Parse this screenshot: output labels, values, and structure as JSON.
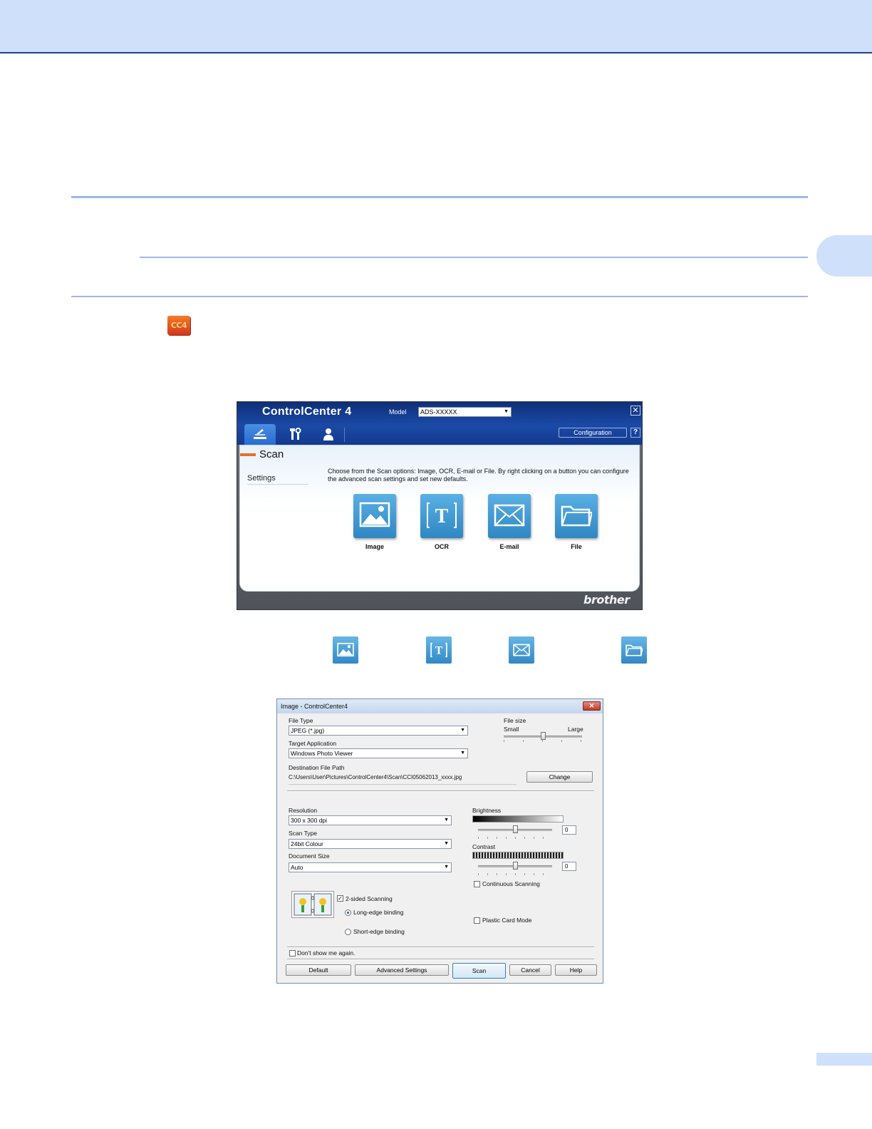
{
  "cc4_icon": {
    "text": "CC4",
    "icon": "controlcenter4-app-icon"
  },
  "controlcenter": {
    "title": "ControlCenter 4",
    "model_label": "Model",
    "model_value": "ADS-XXXXX",
    "tabs": [
      {
        "icon": "scan-tab-icon",
        "selected": true
      },
      {
        "icon": "device-settings-tab-icon",
        "selected": false
      },
      {
        "icon": "support-tab-icon",
        "selected": false
      }
    ],
    "configuration_label": "Configuration",
    "help_label": "?",
    "heading": "Scan",
    "sidebar_item": "Settings",
    "description": "Choose from the Scan options: Image, OCR, E-mail or File. By right clicking on a button you can configure the advanced scan settings and set new defaults.",
    "buttons": [
      {
        "label": "Image",
        "icon": "image-icon"
      },
      {
        "label": "OCR",
        "icon": "ocr-icon"
      },
      {
        "label": "E-mail",
        "icon": "email-icon"
      },
      {
        "label": "File",
        "icon": "folder-icon"
      }
    ],
    "brand": "brother",
    "accent_color": "#1b4aa7"
  },
  "image_dialog": {
    "title": "Image - ControlCenter4",
    "file_type_label": "File Type",
    "file_type_value": "JPEG (*.jpg)",
    "file_size_label": "File size",
    "file_size_small": "Small",
    "file_size_large": "Large",
    "file_size_level": 0.5,
    "target_app_label": "Target Application",
    "target_app_value": "Windows Photo Viewer",
    "dest_path_label": "Destination File Path",
    "dest_path_value": "C:\\Users\\User\\Pictures\\ControlCenter4\\Scan\\CCI05062013_xxxx.jpg",
    "change_label": "Change",
    "resolution_label": "Resolution",
    "resolution_value": "300 x 300 dpi",
    "scan_type_label": "Scan Type",
    "scan_type_value": "24bit Colour",
    "doc_size_label": "Document Size",
    "doc_size_value": "Auto",
    "brightness_label": "Brightness",
    "brightness_value": "0",
    "contrast_label": "Contrast",
    "contrast_value": "0",
    "continuous_label": "Continuous Scanning",
    "continuous_checked": false,
    "two_sided_label": "2-sided Scanning",
    "two_sided_checked": true,
    "long_edge_label": "Long-edge binding",
    "long_edge_selected": true,
    "short_edge_label": "Short-edge binding",
    "short_edge_selected": false,
    "plastic_label": "Plastic Card Mode",
    "plastic_checked": false,
    "dont_show_label": "Don't show me again.",
    "dont_show_checked": false,
    "buttons": {
      "default": "Default",
      "advanced": "Advanced Settings",
      "scan": "Scan",
      "cancel": "Cancel",
      "help": "Help"
    }
  }
}
